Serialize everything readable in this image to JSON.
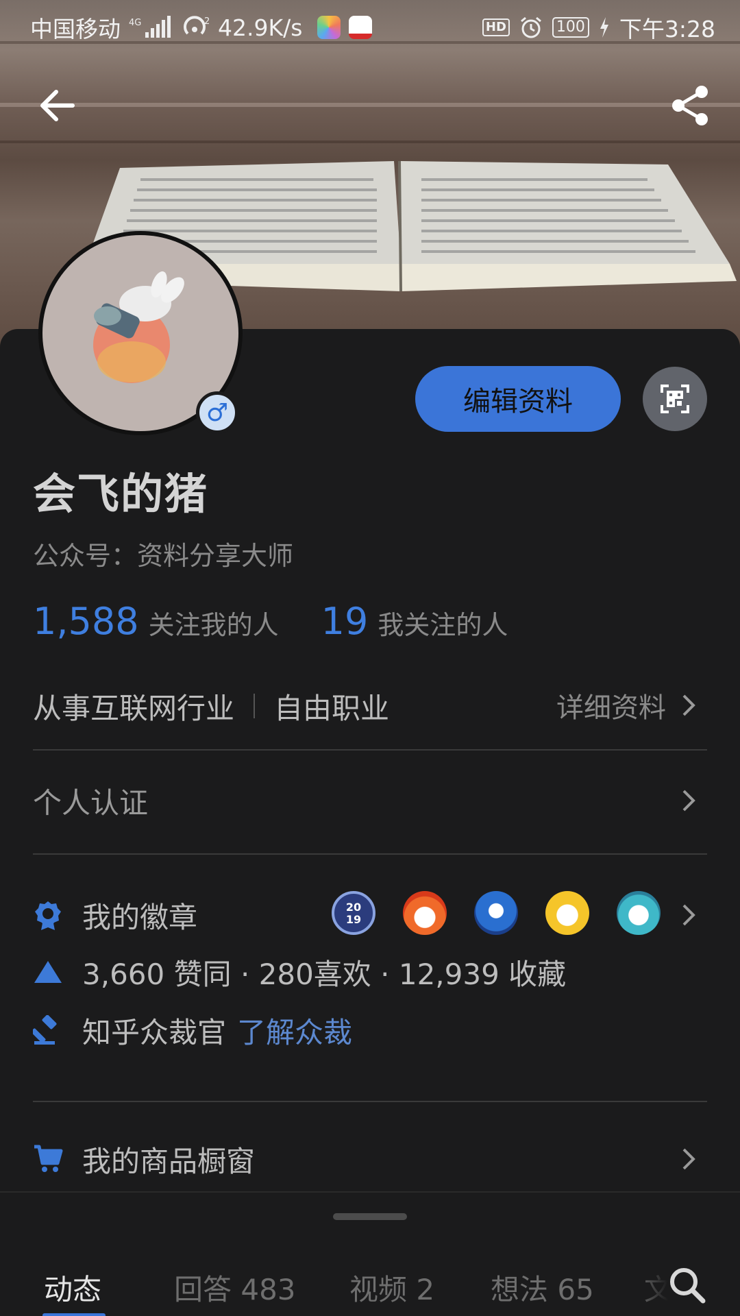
{
  "status_bar": {
    "carrier": "中国移动",
    "network": "4G",
    "hotspot_sup": "2",
    "speed": "42.9K/s",
    "hd": "HD",
    "battery": "100",
    "time": "下午3:28"
  },
  "profile": {
    "name": "会飞的猪",
    "subtitle": "公众号：资料分享大师",
    "gender_symbol": "♂",
    "edit_label": "编辑资料",
    "followers_count": "1,588",
    "followers_label": "关注我的人",
    "following_count": "19",
    "following_label": "我关注的人",
    "industry": "从事互联网行业",
    "occupation": "自由职业",
    "detail_label": "详细资料"
  },
  "rows": {
    "certification": "个人认证",
    "badges_label": "我的徽章",
    "stats": "3,660 赞同 · 280喜欢 · 12,939 收藏",
    "sanction_label": "知乎众裁官",
    "sanction_link": "了解众裁",
    "shop_label": "我的商品橱窗"
  },
  "badge_2019": {
    "top": "20",
    "bottom": "19"
  },
  "tabs": [
    {
      "label": "动态",
      "active": true
    },
    {
      "label": "回答 483",
      "active": false
    },
    {
      "label": "视频 2",
      "active": false
    },
    {
      "label": "想法 65",
      "active": false
    },
    {
      "label": "文",
      "active": false
    }
  ],
  "colors": {
    "accent": "#3b75d8",
    "link": "#5c88cf",
    "background": "#1b1b1c"
  }
}
